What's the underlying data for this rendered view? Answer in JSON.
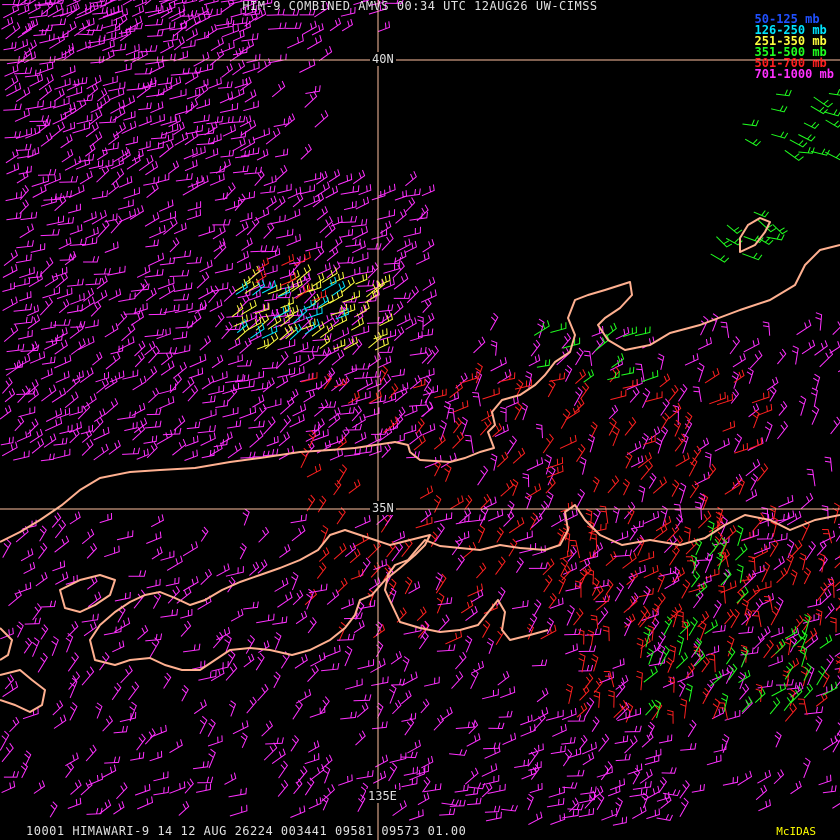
{
  "title": "HIM-9 COMBINED AMVS 00:34 UTC 12AUG26 UW-CIMSS",
  "footer": "10001 HIMAWARI-9 14 12 AUG 26224 003441 09581 09573 01.00",
  "credit": "McIDAS",
  "legend": [
    {
      "label": "50-125 mb",
      "color": "#2050ff"
    },
    {
      "label": "126-250 mb",
      "color": "#00e5ff"
    },
    {
      "label": "251-350 mb",
      "color": "#ffff40"
    },
    {
      "label": "351-500 mb",
      "color": "#20ff20"
    },
    {
      "label": "501-700 mb",
      "color": "#ff2020"
    },
    {
      "label": "701-1000 mb",
      "color": "#ff30ff"
    }
  ],
  "gridlabels": {
    "lat40": "40N",
    "lat35": "35N",
    "lon135": "135E"
  },
  "colors": {
    "grid": "#ffc0a0",
    "coast": "#ffb090",
    "background": "#000000"
  }
}
